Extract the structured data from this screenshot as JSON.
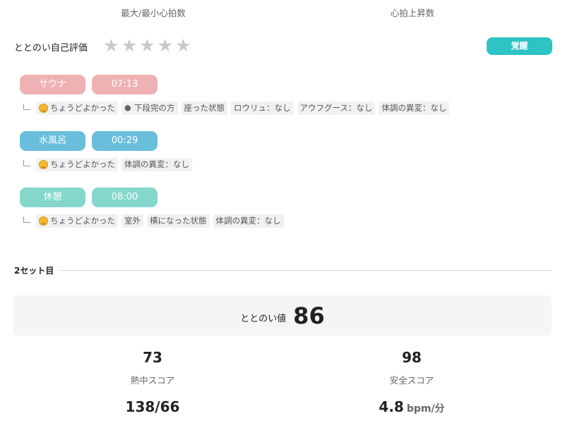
{
  "top_labels": {
    "left": "最大/最小心拍数",
    "right": "心拍上昇数"
  },
  "rating": {
    "title": "ととのい自己評価",
    "stars_total": 5,
    "stars_filled": 0,
    "badge": "覚醒"
  },
  "steps": [
    {
      "name": "サウナ",
      "time": "07:13",
      "color": "#efb2b2",
      "tags": [
        "ちょうどよかった",
        "下段完の方",
        "座った状態",
        "ロウリュ：なし",
        "アウフグース：なし",
        "体調の異変：なし"
      ]
    },
    {
      "name": "水風呂",
      "time": "00:29",
      "color": "#68bedb",
      "tags": [
        "ちょうどよかった",
        "体調の異変：なし"
      ]
    },
    {
      "name": "休憩",
      "time": "08:00",
      "color": "#85d7cc",
      "tags": [
        "ちょうどよかった",
        "室外",
        "横になった状態",
        "体調の異変：なし"
      ]
    }
  ],
  "set": {
    "title": "2セット目"
  },
  "totonoi": {
    "label": "ととのい値",
    "value": "86"
  },
  "scores": {
    "heat": {
      "value": "73",
      "label": "熱中スコア"
    },
    "safety": {
      "value": "98",
      "label": "安全スコア"
    },
    "heart_rate": {
      "value": "138/66"
    },
    "rise": {
      "value": "4.8",
      "unit": "bpm/分"
    }
  },
  "icons": {
    "star": "star-icon",
    "emoji": "smiling-face-icon",
    "cube": "cube-icon"
  }
}
